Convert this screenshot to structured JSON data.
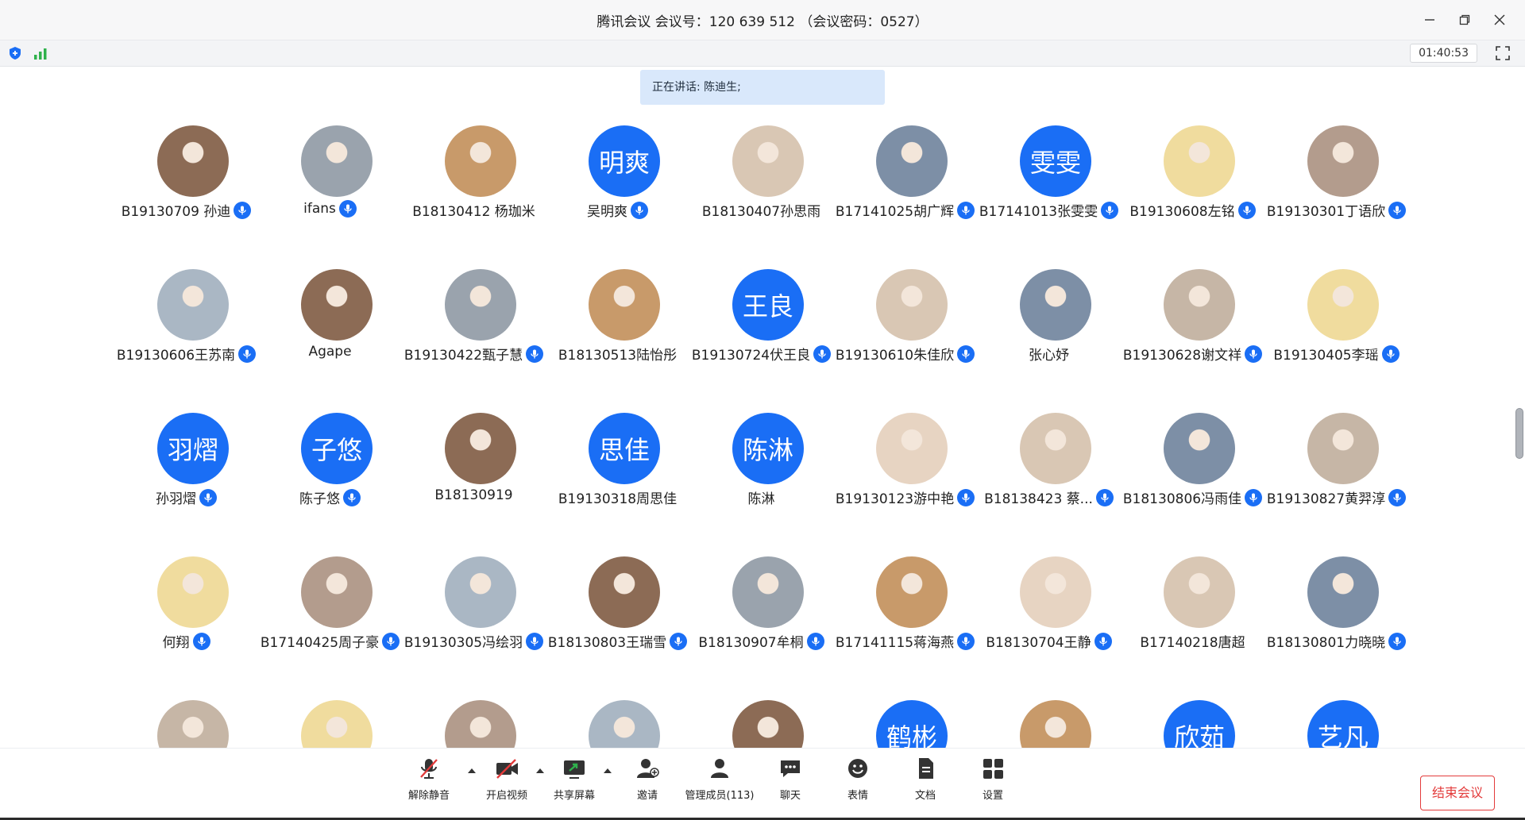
{
  "window": {
    "title": "腾讯会议 会议号：120 639 512 （会议密码：0527）"
  },
  "info_bar": {
    "timer": "01:40:53"
  },
  "speaking_banner": "正在讲话: 陈迪生;",
  "colors": {
    "accent": "#1a6ef5",
    "end_button": "#e33b3b",
    "speaking_bg": "#d9e8fb"
  },
  "participants": [
    {
      "name": "B19130709 孙迪",
      "avatar": "photo",
      "mic": true
    },
    {
      "name": "ifans",
      "avatar": "photo",
      "mic": true
    },
    {
      "name": "B18130412 杨珈米",
      "avatar": "photo",
      "mic": false
    },
    {
      "name": "吴明爽",
      "avatar": "text",
      "avatar_text": "明爽",
      "mic": true
    },
    {
      "name": "B18130407孙思雨",
      "avatar": "photo",
      "mic": false
    },
    {
      "name": "B17141025胡广辉",
      "avatar": "photo",
      "mic": true
    },
    {
      "name": "B17141013张雯雯",
      "avatar": "text",
      "avatar_text": "雯雯",
      "mic": true
    },
    {
      "name": "B19130608左铭",
      "avatar": "photo",
      "mic": true
    },
    {
      "name": "B19130301丁语欣",
      "avatar": "photo",
      "mic": true
    },
    {
      "name": "B19130606王苏南",
      "avatar": "photo",
      "mic": true
    },
    {
      "name": "Agape",
      "avatar": "photo",
      "mic": false
    },
    {
      "name": "B19130422甄子慧",
      "avatar": "photo",
      "mic": true
    },
    {
      "name": "B18130513陆怡彤",
      "avatar": "photo",
      "mic": false
    },
    {
      "name": "B19130724伏王良",
      "avatar": "text",
      "avatar_text": "王良",
      "mic": true
    },
    {
      "name": "B19130610朱佳欣",
      "avatar": "photo",
      "mic": true
    },
    {
      "name": "张心妤",
      "avatar": "photo",
      "mic": false
    },
    {
      "name": "B19130628谢文祥",
      "avatar": "photo",
      "mic": true
    },
    {
      "name": "B19130405李瑶",
      "avatar": "photo",
      "mic": true
    },
    {
      "name": "孙羽熠",
      "avatar": "text",
      "avatar_text": "羽熠",
      "mic": true
    },
    {
      "name": "陈子悠",
      "avatar": "text",
      "avatar_text": "子悠",
      "mic": true
    },
    {
      "name": "B18130919",
      "avatar": "photo",
      "mic": false
    },
    {
      "name": "B19130318周思佳",
      "avatar": "text",
      "avatar_text": "思佳",
      "mic": false
    },
    {
      "name": "陈淋",
      "avatar": "text",
      "avatar_text": "陈淋",
      "mic": false
    },
    {
      "name": "B19130123游中艳",
      "avatar": "photo",
      "mic": true
    },
    {
      "name": "B18138423 蔡...",
      "avatar": "photo",
      "mic": true
    },
    {
      "name": "B18130806冯雨佳",
      "avatar": "photo",
      "mic": true
    },
    {
      "name": "B19130827黄羿淳",
      "avatar": "photo",
      "mic": true
    },
    {
      "name": "何翔",
      "avatar": "photo",
      "mic": true
    },
    {
      "name": "B17140425周子豪",
      "avatar": "photo",
      "mic": true
    },
    {
      "name": "B19130305冯绘羽",
      "avatar": "photo",
      "mic": true
    },
    {
      "name": "B18130803王瑞雪",
      "avatar": "photo",
      "mic": true
    },
    {
      "name": "B18130907牟桐",
      "avatar": "photo",
      "mic": true
    },
    {
      "name": "B17141115蒋海燕",
      "avatar": "photo",
      "mic": true
    },
    {
      "name": "B18130704王静",
      "avatar": "photo",
      "mic": true
    },
    {
      "name": "B17140218唐超",
      "avatar": "photo",
      "mic": false
    },
    {
      "name": "B18130801力晓晓",
      "avatar": "photo",
      "mic": true
    },
    {
      "name": "",
      "avatar": "photo",
      "mic": false
    },
    {
      "name": "",
      "avatar": "photo",
      "mic": false
    },
    {
      "name": "",
      "avatar": "photo",
      "mic": false
    },
    {
      "name": "",
      "avatar": "photo",
      "mic": false
    },
    {
      "name": "",
      "avatar": "photo",
      "mic": false
    },
    {
      "name": "",
      "avatar": "text",
      "avatar_text": "鹤彬",
      "mic": false
    },
    {
      "name": "",
      "avatar": "photo",
      "mic": false
    },
    {
      "name": "",
      "avatar": "text",
      "avatar_text": "欣茹",
      "mic": false
    },
    {
      "name": "",
      "avatar": "text",
      "avatar_text": "艺凡",
      "mic": false
    }
  ],
  "toolbar": {
    "unmute": "解除静音",
    "start_video": "开启视频",
    "share_screen": "共享屏幕",
    "invite": "邀请",
    "manage_members": "管理成员(113)",
    "chat": "聊天",
    "reactions": "表情",
    "documents": "文档",
    "settings": "设置",
    "end_meeting": "结束会议"
  }
}
